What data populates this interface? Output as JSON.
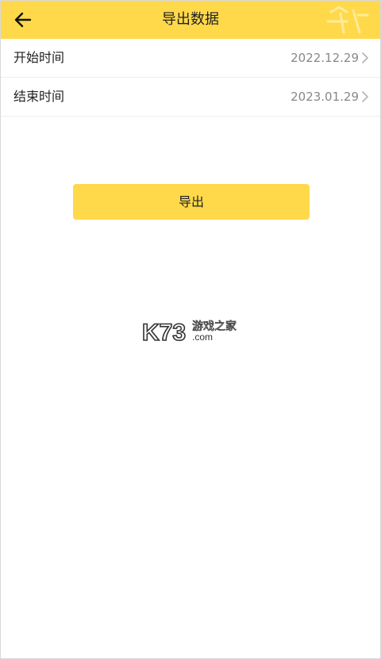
{
  "header": {
    "title": "导出数据",
    "back_icon": "arrow-left-icon",
    "accent_color": "#ffd94a"
  },
  "rows": [
    {
      "label": "开始时间",
      "value": "2022.12.29",
      "icon": "chevron-right-icon"
    },
    {
      "label": "结束时间",
      "value": "2023.01.29",
      "icon": "chevron-right-icon"
    }
  ],
  "export_button": {
    "label": "导出"
  },
  "logo": {
    "text": "K73",
    "sub": ".com",
    "cn": "游戏之家"
  }
}
